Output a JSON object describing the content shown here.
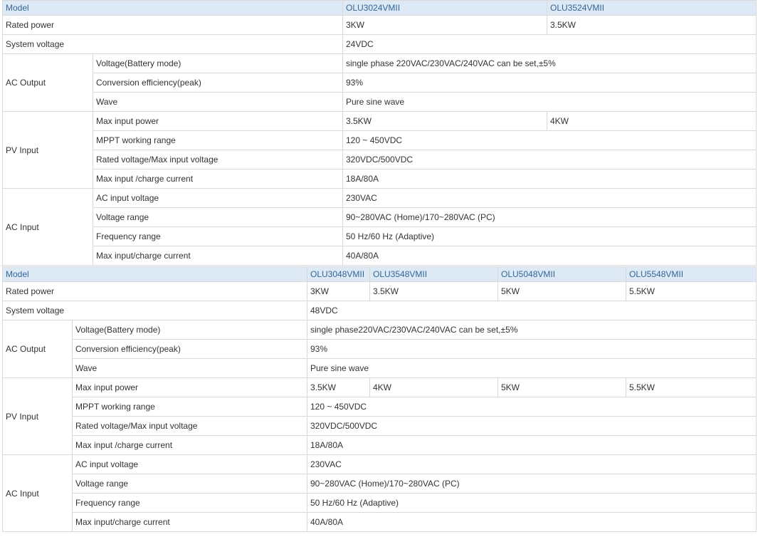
{
  "table1": {
    "model_label": "Model",
    "models": [
      "OLU3024VMII",
      "OLU3524VMII"
    ],
    "rated_power_label": "Rated power",
    "rated_power": [
      "3KW",
      "3.5KW"
    ],
    "system_voltage_label": "System voltage",
    "system_voltage": "24VDC",
    "ac_output": {
      "label": "AC Output",
      "voltage_label": "Voltage(Battery mode)",
      "voltage": "single phase 220VAC/230VAC/240VAC can be set,±5%",
      "efficiency_label": "Conversion efficiency(peak)",
      "efficiency": "93%",
      "wave_label": "Wave",
      "wave": "Pure sine wave"
    },
    "pv_input": {
      "label": "PV Input",
      "max_power_label": "Max input power",
      "max_power": [
        "3.5KW",
        "4KW"
      ],
      "mppt_label": "MPPT working range",
      "mppt": "120 ~ 450VDC",
      "rated_voltage_label": "Rated voltage/Max input voltage",
      "rated_voltage": "320VDC/500VDC",
      "current_label": "Max input /charge current",
      "current": "18A/80A"
    },
    "ac_input": {
      "label": "AC Input",
      "voltage_label": "AC input voltage",
      "voltage": "230VAC",
      "range_label": "Voltage range",
      "range": "90~280VAC (Home)/170~280VAC (PC)",
      "freq_label": "Frequency range",
      "freq": "50 Hz/60 Hz (Adaptive)",
      "current_label": "Max input/charge current",
      "current": "40A/80A"
    }
  },
  "table2": {
    "model_label": "Model",
    "models": [
      "OLU3048VMII",
      "OLU3548VMII",
      "OLU5048VMII",
      "OLU5548VMII"
    ],
    "rated_power_label": "Rated power",
    "rated_power": [
      "3KW",
      "3.5KW",
      "5KW",
      "5.5KW"
    ],
    "system_voltage_label": "System voltage",
    "system_voltage": "48VDC",
    "ac_output": {
      "label": "AC Output",
      "voltage_label": "Voltage(Battery mode)",
      "voltage": "single phase220VAC/230VAC/240VAC can be set,±5%",
      "efficiency_label": "Conversion efficiency(peak)",
      "efficiency": "93%",
      "wave_label": "Wave",
      "wave": "Pure sine wave"
    },
    "pv_input": {
      "label": "PV Input",
      "max_power_label": "Max input power",
      "max_power": [
        "3.5KW",
        "4KW",
        "5KW",
        "5.5KW"
      ],
      "mppt_label": "MPPT working range",
      "mppt": "120 ~ 450VDC",
      "rated_voltage_label": "Rated voltage/Max input voltage",
      "rated_voltage": "320VDC/500VDC",
      "current_label": "Max input /charge current",
      "current": "18A/80A"
    },
    "ac_input": {
      "label": "AC Input",
      "voltage_label": "AC input voltage",
      "voltage": "230VAC",
      "range_label": "Voltage range",
      "range": "90~280VAC (Home)/170~280VAC (PC)",
      "freq_label": "Frequency range",
      "freq": "50 Hz/60 Hz (Adaptive)",
      "current_label": "Max input/charge current",
      "current": "40A/80A"
    }
  }
}
